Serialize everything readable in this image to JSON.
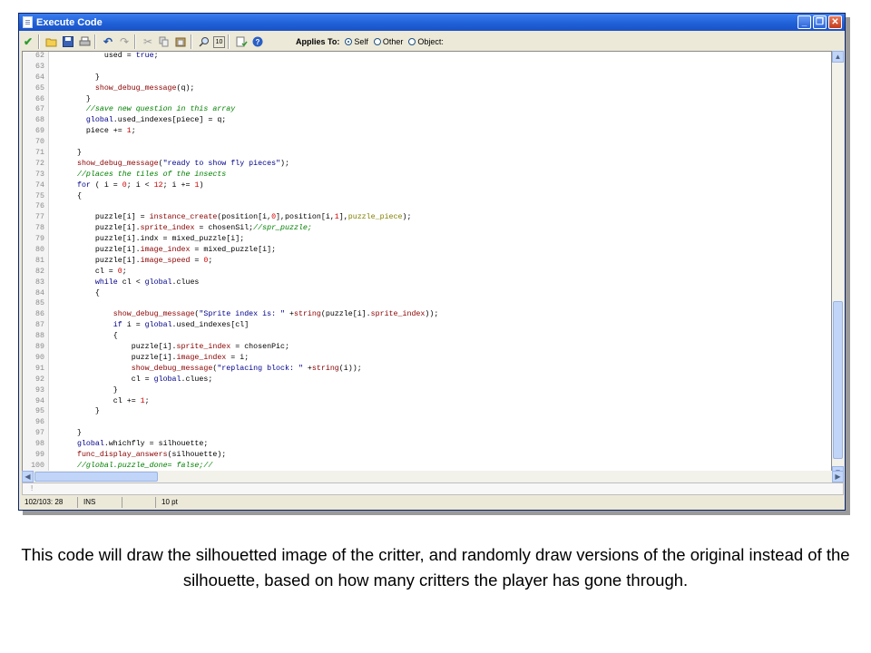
{
  "window": {
    "title": "Execute Code",
    "buttons": {
      "minimize": "_",
      "maximize": "❐",
      "close": "✕"
    }
  },
  "toolbar": {
    "icons": [
      "check-icon",
      "open-folder-icon",
      "save-icon",
      "print-icon",
      "undo-icon",
      "redo-icon",
      "cut-icon",
      "copy-icon",
      "paste-icon",
      "find-icon",
      "goto-line-icon",
      "check-script-icon",
      "help-icon"
    ],
    "applies_to_label": "Applies To:",
    "options": [
      {
        "label": "Self",
        "selected": true
      },
      {
        "label": "Other",
        "selected": false
      },
      {
        "label": "Object:",
        "selected": false
      }
    ]
  },
  "editor": {
    "lines": [
      {
        "n": "62",
        "indent": 8,
        "segs": [
          [
            "p",
            "used = "
          ],
          [
            "kw",
            "true"
          ],
          [
            "p",
            ";"
          ]
        ]
      },
      {
        "n": "63",
        "indent": 0,
        "segs": []
      },
      {
        "n": "64",
        "indent": 6,
        "segs": [
          [
            "p",
            "}"
          ]
        ]
      },
      {
        "n": "65",
        "indent": 6,
        "segs": [
          [
            "fn",
            "show_debug_message"
          ],
          [
            "p",
            "(q);"
          ]
        ]
      },
      {
        "n": "66",
        "indent": 4,
        "segs": [
          [
            "p",
            "}"
          ]
        ]
      },
      {
        "n": "67",
        "indent": 4,
        "segs": [
          [
            "cm",
            "//save new question in this array"
          ]
        ]
      },
      {
        "n": "68",
        "indent": 4,
        "segs": [
          [
            "gl",
            "global"
          ],
          [
            "p",
            ".used_indexes[piece] = q;"
          ]
        ]
      },
      {
        "n": "69",
        "indent": 4,
        "segs": [
          [
            "p",
            "piece += "
          ],
          [
            "num",
            "1"
          ],
          [
            "p",
            ";"
          ]
        ]
      },
      {
        "n": "70",
        "indent": 0,
        "segs": []
      },
      {
        "n": "71",
        "indent": 2,
        "segs": [
          [
            "p",
            "}"
          ]
        ]
      },
      {
        "n": "72",
        "indent": 2,
        "segs": [
          [
            "fn",
            "show_debug_message"
          ],
          [
            "p",
            "("
          ],
          [
            "str",
            "\"ready to show fly pieces\""
          ],
          [
            "p",
            ");"
          ]
        ]
      },
      {
        "n": "73",
        "indent": 2,
        "segs": [
          [
            "cm",
            "//places the tiles of the insects"
          ]
        ]
      },
      {
        "n": "74",
        "indent": 2,
        "segs": [
          [
            "kw",
            "for"
          ],
          [
            "p",
            " ( i = "
          ],
          [
            "num",
            "0"
          ],
          [
            "p",
            "; i < "
          ],
          [
            "num",
            "12"
          ],
          [
            "p",
            "; i += "
          ],
          [
            "num",
            "1"
          ],
          [
            "p",
            ")"
          ]
        ]
      },
      {
        "n": "75",
        "indent": 2,
        "segs": [
          [
            "p",
            "{"
          ]
        ]
      },
      {
        "n": "76",
        "indent": 0,
        "segs": []
      },
      {
        "n": "77",
        "indent": 6,
        "segs": [
          [
            "p",
            "puzzle[i] = "
          ],
          [
            "fn",
            "instance_create"
          ],
          [
            "p",
            "(position[i,"
          ],
          [
            "num",
            "0"
          ],
          [
            "p",
            "],position[i,"
          ],
          [
            "num",
            "1"
          ],
          [
            "p",
            "],"
          ],
          [
            "asset",
            "puzzle_piece"
          ],
          [
            "p",
            ");"
          ]
        ]
      },
      {
        "n": "78",
        "indent": 6,
        "segs": [
          [
            "p",
            "puzzle[i]."
          ],
          [
            "id",
            "sprite_index"
          ],
          [
            "p",
            " = chosenSil;"
          ],
          [
            "cm",
            "//spr_puzzle;"
          ]
        ]
      },
      {
        "n": "79",
        "indent": 6,
        "segs": [
          [
            "p",
            "puzzle[i].indx = mixed_puzzle[i];"
          ]
        ]
      },
      {
        "n": "80",
        "indent": 6,
        "segs": [
          [
            "p",
            "puzzle[i]."
          ],
          [
            "id",
            "image_index"
          ],
          [
            "p",
            " = mixed_puzzle[i];"
          ]
        ]
      },
      {
        "n": "81",
        "indent": 6,
        "segs": [
          [
            "p",
            "puzzle[i]."
          ],
          [
            "id",
            "image_speed"
          ],
          [
            "p",
            " = "
          ],
          [
            "num",
            "0"
          ],
          [
            "p",
            ";"
          ]
        ]
      },
      {
        "n": "82",
        "indent": 6,
        "segs": [
          [
            "p",
            "cl = "
          ],
          [
            "num",
            "0"
          ],
          [
            "p",
            ";"
          ]
        ]
      },
      {
        "n": "83",
        "indent": 6,
        "segs": [
          [
            "kw",
            "while"
          ],
          [
            "p",
            " cl < "
          ],
          [
            "gl",
            "global"
          ],
          [
            "p",
            ".clues"
          ]
        ]
      },
      {
        "n": "84",
        "indent": 6,
        "segs": [
          [
            "p",
            "{"
          ]
        ]
      },
      {
        "n": "85",
        "indent": 0,
        "segs": []
      },
      {
        "n": "86",
        "indent": 10,
        "segs": [
          [
            "fn",
            "show_debug_message"
          ],
          [
            "p",
            "("
          ],
          [
            "str",
            "\"Sprite index is: \""
          ],
          [
            "p",
            " +"
          ],
          [
            "fn",
            "string"
          ],
          [
            "p",
            "(puzzle[i]."
          ],
          [
            "id",
            "sprite_index"
          ],
          [
            "p",
            "));"
          ]
        ]
      },
      {
        "n": "87",
        "indent": 10,
        "segs": [
          [
            "kw",
            "if"
          ],
          [
            "p",
            " i = "
          ],
          [
            "gl",
            "global"
          ],
          [
            "p",
            ".used_indexes[cl]"
          ]
        ]
      },
      {
        "n": "88",
        "indent": 10,
        "segs": [
          [
            "p",
            "{"
          ]
        ]
      },
      {
        "n": "89",
        "indent": 14,
        "segs": [
          [
            "p",
            "puzzle[i]."
          ],
          [
            "id",
            "sprite_index"
          ],
          [
            "p",
            " = chosenPic;"
          ]
        ]
      },
      {
        "n": "90",
        "indent": 14,
        "segs": [
          [
            "p",
            "puzzle[i]."
          ],
          [
            "id",
            "image_index"
          ],
          [
            "p",
            " = i;"
          ]
        ]
      },
      {
        "n": "91",
        "indent": 14,
        "segs": [
          [
            "fn",
            "show_debug_message"
          ],
          [
            "p",
            "("
          ],
          [
            "str",
            "\"replacing block: \""
          ],
          [
            "p",
            " +"
          ],
          [
            "fn",
            "string"
          ],
          [
            "p",
            "(i));"
          ]
        ]
      },
      {
        "n": "92",
        "indent": 14,
        "segs": [
          [
            "p",
            "cl = "
          ],
          [
            "gl",
            "global"
          ],
          [
            "p",
            ".clues;"
          ]
        ]
      },
      {
        "n": "93",
        "indent": 10,
        "segs": [
          [
            "p",
            "}"
          ]
        ]
      },
      {
        "n": "94",
        "indent": 10,
        "segs": [
          [
            "p",
            "cl += "
          ],
          [
            "num",
            "1"
          ],
          [
            "p",
            ";"
          ]
        ]
      },
      {
        "n": "95",
        "indent": 6,
        "segs": [
          [
            "p",
            "}"
          ]
        ]
      },
      {
        "n": "96",
        "indent": 0,
        "segs": []
      },
      {
        "n": "97",
        "indent": 2,
        "segs": [
          [
            "p",
            "}"
          ]
        ]
      },
      {
        "n": "98",
        "indent": 2,
        "segs": [
          [
            "gl",
            "global"
          ],
          [
            "p",
            ".whichfly = silhouette;"
          ]
        ]
      },
      {
        "n": "99",
        "indent": 2,
        "segs": [
          [
            "fn",
            "func_display_answers"
          ],
          [
            "p",
            "(silhouette);"
          ]
        ]
      },
      {
        "n": "100",
        "indent": 2,
        "segs": [
          [
            "cm",
            "//global.puzzle_done= false;//"
          ]
        ]
      }
    ]
  },
  "lower_pane_text": "!",
  "statusbar": {
    "position": "102/103:  28",
    "mode": "INS",
    "font_size": "10 pt"
  },
  "caption": "This code will draw the silhouetted image of the critter, and randomly draw versions of the original instead of the silhouette, based on how many critters the player has gone through."
}
